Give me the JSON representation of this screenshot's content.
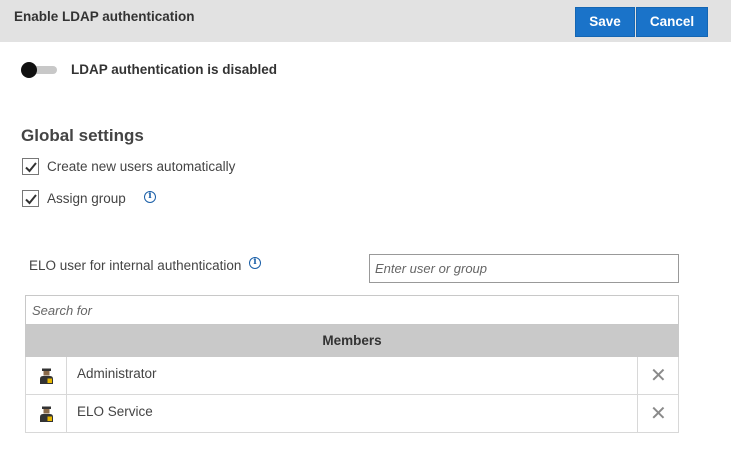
{
  "header": {
    "title": "Enable LDAP authentication",
    "save_label": "Save",
    "cancel_label": "Cancel"
  },
  "ldap_toggle": {
    "state": "off",
    "label": "LDAP authentication is disabled"
  },
  "global_settings": {
    "title": "Global settings",
    "options": [
      {
        "label": "Create new users automatically",
        "checked": true
      },
      {
        "label": "Assign group",
        "checked": true,
        "has_info": true
      }
    ]
  },
  "internal_auth": {
    "label": "ELO user for internal authentication",
    "placeholder": "Enter user or group",
    "value": ""
  },
  "members": {
    "search_placeholder": "Search for",
    "header": "Members",
    "rows": [
      {
        "name": "Administrator",
        "icon": "user-icon"
      },
      {
        "name": "ELO Service",
        "icon": "user-icon"
      }
    ]
  },
  "colors": {
    "accent": "#1a73c9",
    "topbar_bg": "#e2e2e2",
    "members_header_bg": "#c9c9c9"
  }
}
